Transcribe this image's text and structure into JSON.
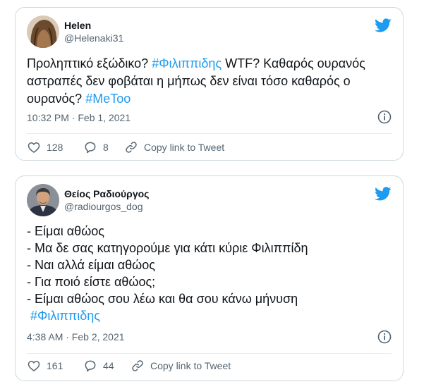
{
  "tweets": [
    {
      "display_name": "Helen",
      "handle": "@Helenaki31",
      "lines": [
        [
          {
            "text": "Προληπτικό εξώδικο? "
          },
          {
            "text": "#Φιλιππιδης",
            "hashtag": true
          },
          {
            "text": " WTF? Καθαρός ουρανός"
          }
        ],
        [
          {
            "text": "αστραπές δεν φοβάται η μήπως δεν είναι τόσο καθαρός ο"
          }
        ],
        [
          {
            "text": "ουρανός? "
          },
          {
            "text": "#MeToo",
            "hashtag": true
          }
        ]
      ],
      "timestamp": "10:32 PM · Feb 1, 2021",
      "likes": "128",
      "replies": "8",
      "copy_link": "Copy link to Tweet",
      "avatar_icon": "hair-portrait-avatar"
    },
    {
      "display_name": "Θείος Ραδιούργος",
      "handle": "@radiourgos_dog",
      "lines": [
        [
          {
            "text": "- Είμαι αθώος"
          }
        ],
        [
          {
            "text": "- Μα δε σας κατηγορούμε για κάτι κύριε Φιλιππίδη"
          }
        ],
        [
          {
            "text": "- Ναι αλλά είμαι αθώος"
          }
        ],
        [
          {
            "text": "- Για ποιό είστε αθώος;"
          }
        ],
        [
          {
            "text": "- Είμαι αθώος σου λέω και θα σου κάνω μήνυση"
          }
        ],
        [
          {
            "text": "#Φιλιππιδης",
            "hashtag": true
          }
        ]
      ],
      "timestamp": "4:38 AM · Feb 2, 2021",
      "likes": "161",
      "replies": "44",
      "copy_link": "Copy link to Tweet",
      "avatar_icon": "man-portrait-avatar"
    }
  ],
  "colors": {
    "accent": "#1d9bf0",
    "secondary_text": "#536471",
    "border": "#cfd9de"
  }
}
